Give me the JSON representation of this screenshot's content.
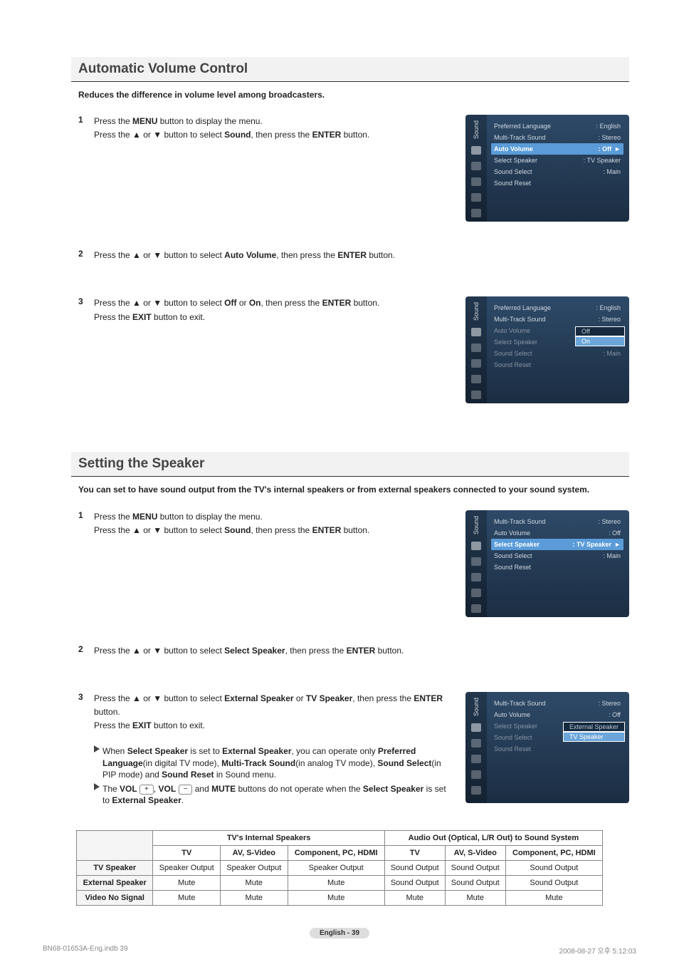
{
  "section1": {
    "title": "Automatic Volume Control",
    "intro": "Reduces the difference in volume level among broadcasters.",
    "steps": [
      {
        "num": "1",
        "html": "Press the <b>MENU</b> button to display the menu.<br>Press the ▲ or ▼ button to select <b>Sound</b>, then press the <b>ENTER</b> button."
      },
      {
        "num": "2",
        "html": "Press the ▲ or ▼ button to select <b>Auto Volume</b>, then press the <b>ENTER</b> button."
      },
      {
        "num": "3",
        "html": "Press the ▲ or ▼ button to select <b>Off</b> or <b>On</b>, then press the <b>ENTER</b> button.<br>Press the <b>EXIT</b> button to exit."
      }
    ],
    "panelA": {
      "side_label": "Sound",
      "rows": [
        {
          "lbl": "Preferred Language",
          "val": ": English"
        },
        {
          "lbl": "Multi-Track Sound",
          "val": ": Stereo"
        },
        {
          "lbl": "Auto Volume",
          "val": ": Off",
          "hl": true,
          "arrow": "►"
        },
        {
          "lbl": "Select Speaker",
          "val": ": TV Speaker"
        },
        {
          "lbl": "Sound Select",
          "val": ": Main"
        },
        {
          "lbl": "Sound Reset",
          "val": ""
        }
      ]
    },
    "panelB": {
      "side_label": "Sound",
      "rows": [
        {
          "lbl": "Preferred Language",
          "val": ": English"
        },
        {
          "lbl": "Multi-Track Sound",
          "val": ": Stereo"
        },
        {
          "lbl": "Auto Volume",
          "val": ":",
          "opts": [
            "Off",
            "On"
          ],
          "opt_sel": 1,
          "dim": true
        },
        {
          "lbl": "Select Speaker",
          "val": ":",
          "dim": true
        },
        {
          "lbl": "Sound Select",
          "val": ": Main",
          "dim": true
        },
        {
          "lbl": "Sound Reset",
          "val": "",
          "dim": true
        }
      ]
    }
  },
  "section2": {
    "title": "Setting the Speaker",
    "intro": "You can set to have sound output from the TV's internal speakers or from external speakers connected to your sound system.",
    "steps": [
      {
        "num": "1",
        "html": "Press the <b>MENU</b> button to display the menu.<br>Press the ▲ or ▼ button to select <b>Sound</b>, then press the <b>ENTER</b> button."
      },
      {
        "num": "2",
        "html": "Press the ▲ or ▼ button to select <b>Select Speaker</b>, then press the <b>ENTER</b> button."
      },
      {
        "num": "3",
        "html": "Press the ▲ or ▼ button to select <b>External Speaker</b> or <b>TV Speaker</b>, then press the <b>ENTER</b> button.<br>Press the <b>EXIT</b> button to exit."
      }
    ],
    "notes": [
      "When <b>Select Speaker</b> is set to <b>External Speaker</b>, you can operate only <b>Preferred Language</b>(in digital TV mode), <b>Multi-Track Sound</b>(in analog TV mode), <b>Sound Select</b>(in PIP mode) and <b>Sound Reset</b> in Sound menu.",
      "The <b>VOL</b> <span class='vol-btn'>+</span>, <b>VOL</b> <span class='vol-btn'>−</span> and <b>MUTE</b> buttons do not operate when the <b>Select Speaker</b> is set to <b>External Speaker</b>."
    ],
    "panelA": {
      "side_label": "Sound",
      "rows": [
        {
          "lbl": "Multi-Track Sound",
          "val": ": Stereo"
        },
        {
          "lbl": "Auto Volume",
          "val": ": Off"
        },
        {
          "lbl": "Select Speaker",
          "val": ": TV Speaker",
          "hl": true,
          "arrow": "►"
        },
        {
          "lbl": "Sound Select",
          "val": ": Main"
        },
        {
          "lbl": "Sound Reset",
          "val": ""
        }
      ]
    },
    "panelB": {
      "side_label": "Sound",
      "rows": [
        {
          "lbl": "Multi-Track Sound",
          "val": ": Stereo"
        },
        {
          "lbl": "Auto Volume",
          "val": ": Off"
        },
        {
          "lbl": "Select Speaker",
          "val": ":",
          "opts": [
            "External Speaker",
            "TV Speaker"
          ],
          "opt_sel": 1,
          "dim": true
        },
        {
          "lbl": "Sound Select",
          "val": ":",
          "dim": true
        },
        {
          "lbl": "Sound Reset",
          "val": "",
          "dim": true
        }
      ]
    }
  },
  "table": {
    "group1": "TV's Internal Speakers",
    "group2": "Audio Out (Optical, L/R Out) to Sound System",
    "sub1": "TV",
    "sub2": "AV, S-Video",
    "sub3": "Component, PC, HDMI",
    "sub4": "TV",
    "sub5": "AV, S-Video",
    "sub6": "Component, PC, HDMI",
    "rows": [
      {
        "h": "TV Speaker",
        "c": [
          "Speaker Output",
          "Speaker Output",
          "Speaker Output",
          "Sound Output",
          "Sound Output",
          "Sound Output"
        ]
      },
      {
        "h": "External Speaker",
        "c": [
          "Mute",
          "Mute",
          "Mute",
          "Sound Output",
          "Sound Output",
          "Sound Output"
        ]
      },
      {
        "h": "Video No Signal",
        "c": [
          "Mute",
          "Mute",
          "Mute",
          "Mute",
          "Mute",
          "Mute"
        ]
      }
    ]
  },
  "footer": {
    "page": "English - 39",
    "file": "BN68-01653A-Eng.indb   39",
    "date": "2008-08-27   오후 5:12:03"
  }
}
